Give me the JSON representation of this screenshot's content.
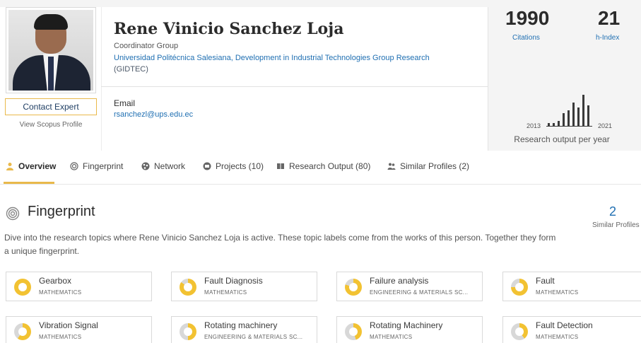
{
  "profile": {
    "name": "Rene Vinicio Sanchez Loja",
    "role": "Coordinator Group",
    "affiliation_link": "Universidad Politécnica Salesiana, Development in Industrial Technologies Group Research",
    "affiliation_suffix": "(GIDTEC)",
    "contact_button": "Contact Expert",
    "scopus_link": "View Scopus Profile",
    "email_label": "Email",
    "email": "rsanchezl@ups.edu.ec"
  },
  "metrics": {
    "citations_value": "1990",
    "citations_label": "Citations",
    "hindex_value": "21",
    "hindex_label": "h-Index",
    "chart_start_year": "2013",
    "chart_end_year": "2021",
    "chart_label": "Research output per year"
  },
  "chart_data": {
    "type": "bar",
    "categories": [
      "2013",
      "2014",
      "2015",
      "2016",
      "2017",
      "2018",
      "2019",
      "2020",
      "2021"
    ],
    "values": [
      1,
      1,
      2,
      5,
      6,
      9,
      7,
      12,
      8
    ],
    "xlabel": "",
    "ylabel": "",
    "title": "Research output per year"
  },
  "tabs": [
    {
      "label": "Overview",
      "icon": "person-icon"
    },
    {
      "label": "Fingerprint",
      "icon": "fingerprint-icon"
    },
    {
      "label": "Network",
      "icon": "network-icon"
    },
    {
      "label": "Projects (10)",
      "icon": "projects-icon"
    },
    {
      "label": "Research Output (80)",
      "icon": "book-icon"
    },
    {
      "label": "Similar Profiles (2)",
      "icon": "people-icon"
    }
  ],
  "fingerprint": {
    "title": "Fingerprint",
    "description": "Dive into the research topics where Rene Vinicio Sanchez Loja is active. These topic labels come from the works of this person. Together they form a unique fingerprint.",
    "similar_count": "2",
    "similar_label": "Similar Profiles",
    "topics": [
      {
        "name": "Gearbox",
        "category": "Mathematics",
        "strength": 1.0
      },
      {
        "name": "Fault Diagnosis",
        "category": "Mathematics",
        "strength": 0.85
      },
      {
        "name": "Failure analysis",
        "category": "Engineering & Materials Sc...",
        "strength": 0.8
      },
      {
        "name": "Fault",
        "category": "Mathematics",
        "strength": 0.75
      },
      {
        "name": "Vibration Signal",
        "category": "Mathematics",
        "strength": 0.6
      },
      {
        "name": "Rotating machinery",
        "category": "Engineering & Materials Sc...",
        "strength": 0.5
      },
      {
        "name": "Rotating Machinery",
        "category": "Mathematics",
        "strength": 0.45
      },
      {
        "name": "Fault Detection",
        "category": "Mathematics",
        "strength": 0.4
      }
    ]
  },
  "colors": {
    "accent": "#e9b94b",
    "link": "#1f6fb2",
    "topic_strong": "#f2c232",
    "topic_weak": "#d8d8d8"
  }
}
